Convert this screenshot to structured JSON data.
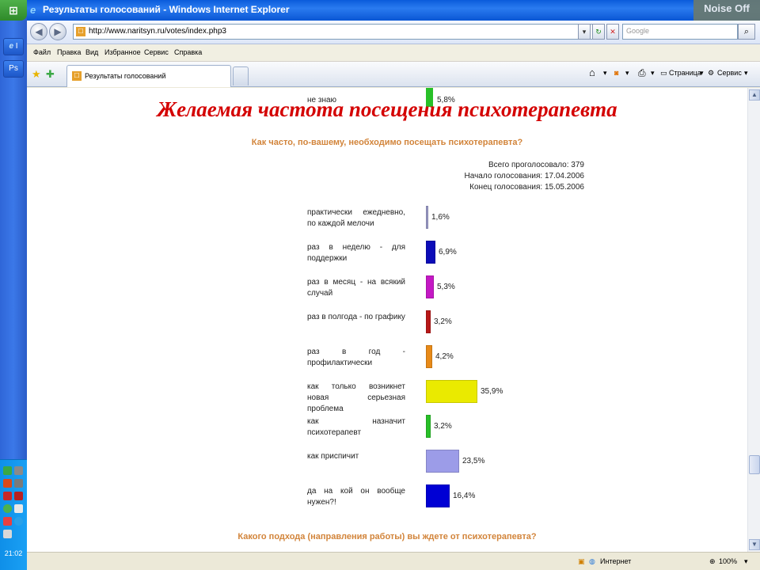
{
  "window": {
    "title": "Результаты голосований - Windows Internet Explorer",
    "watermark": "Noise Off"
  },
  "taskbar": {
    "task1": "I",
    "task2": "Ps",
    "clock": "21:02"
  },
  "address": {
    "url": "http://www.naritsyn.ru/votes/index.php3",
    "search_placeholder": "Google"
  },
  "menu": [
    "Файл",
    "Правка",
    "Вид",
    "Избранное",
    "Сервис",
    "Справка"
  ],
  "tabs": {
    "active_label": "Результаты голосований"
  },
  "commands": {
    "page": "Страница",
    "tools": "Сервис"
  },
  "content": {
    "overlay_title": "Желаемая частота посещения психотерапевта",
    "top_row": {
      "label": "не знаю",
      "percent": "5,8%"
    },
    "question": "Как часто, по-вашему, необходимо посещать психотерапевта?",
    "meta": {
      "total": "Всего проголосовало: 379",
      "start": "Начало голосования: 17.04.2006",
      "end": "Конец голосования: 15.05.2006"
    },
    "options": [
      {
        "label": "практически ежедневно, по каждой мелочи",
        "percent": "1,6%"
      },
      {
        "label": "раз в неделю - для поддержки",
        "percent": "6,9%"
      },
      {
        "label": "раз в месяц - на всякий случай",
        "percent": "5,3%"
      },
      {
        "label": "раз в полгода - по графику",
        "percent": "3,2%"
      },
      {
        "label": "раз в год - профилактически",
        "percent": "4,2%"
      },
      {
        "label": "как только возникнет новая серьезная проблема",
        "percent": "35,9%"
      },
      {
        "label": "как назначит психотерапевт",
        "percent": "3,2%"
      },
      {
        "label": "как приспичит",
        "percent": "23,5%"
      },
      {
        "label": "да на кой он вообще нужен?!",
        "percent": "16,4%"
      }
    ],
    "next_question": "Какого подхода (направления работы) вы ждете от психотерапевта?"
  },
  "chart_data": {
    "type": "bar",
    "orientation": "horizontal",
    "categories": [
      "практически ежедневно, по каждой мелочи",
      "раз в неделю - для поддержки",
      "раз в месяц - на всякий случай",
      "раз в полгода - по графику",
      "раз в год - профилактически",
      "как только возникнет новая серьезная проблема",
      "как назначит психотерапевт",
      "как приспичит",
      "да на кой он вообще нужен?!"
    ],
    "values": [
      1.6,
      6.9,
      5.3,
      3.2,
      4.2,
      35.9,
      3.2,
      23.5,
      16.4
    ],
    "colors": [
      "#9a9ac8",
      "#0c0cb8",
      "#c418c4",
      "#b81818",
      "#e88a18",
      "#eaea00",
      "#28c028",
      "#9c9ce8",
      "#0000d4"
    ],
    "title": "Как часто, по-вашему, необходимо посещать психотерапевта?"
  },
  "status": {
    "zone": "Интернет",
    "zoom": "100%"
  }
}
